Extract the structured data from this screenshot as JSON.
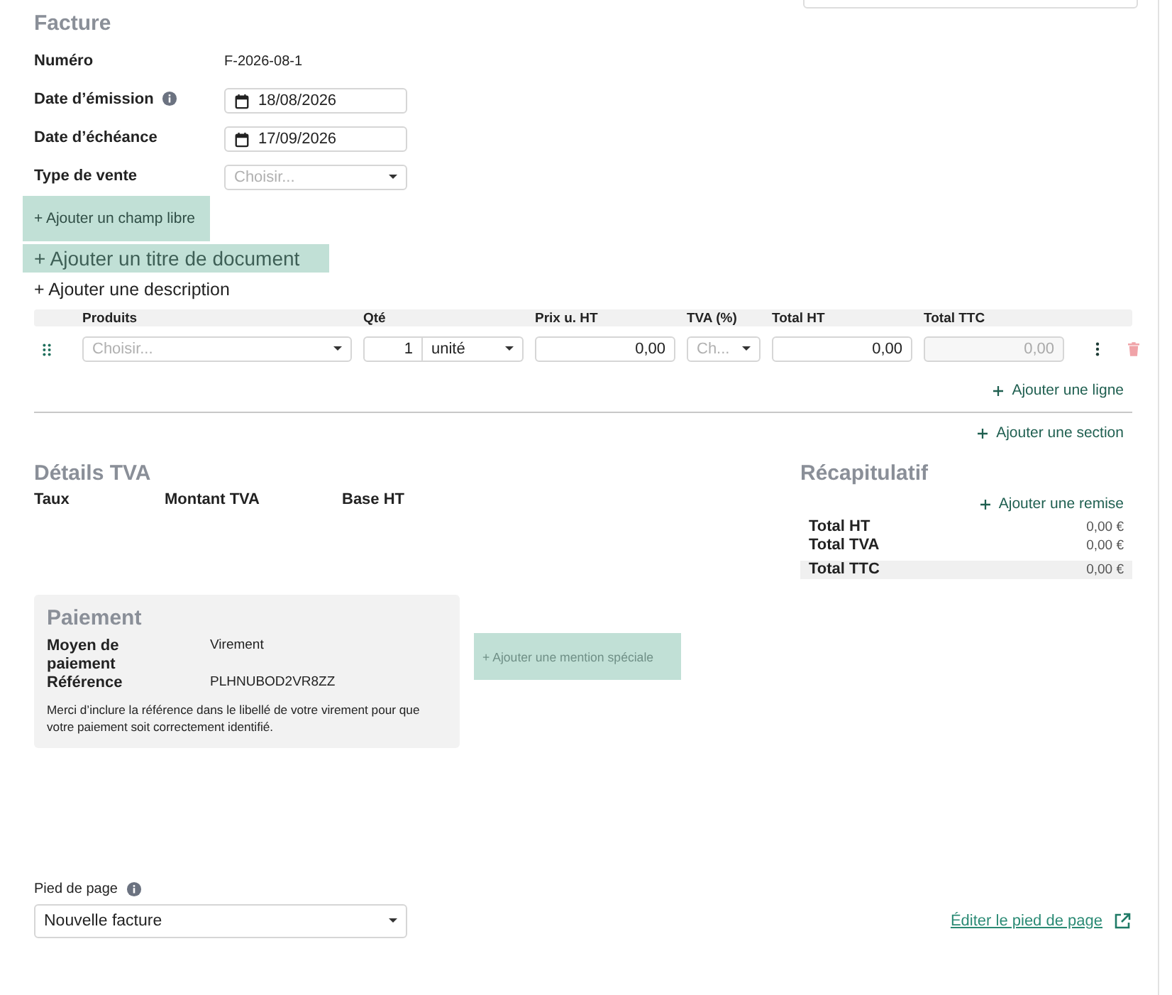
{
  "invoice": {
    "title": "Facture",
    "fields": [
      {
        "label": "Numéro",
        "kind": "text",
        "value": "F-2026-08-1",
        "info": false
      },
      {
        "label": "Date d’émission",
        "kind": "date",
        "value": "18/08/2026",
        "info": true
      },
      {
        "label": "Date d’échéance",
        "kind": "date",
        "value": "17/09/2026",
        "info": false
      },
      {
        "label": "Type de vente",
        "kind": "select",
        "placeholder": "Choisir...",
        "info": false
      }
    ]
  },
  "add_free_field": "+ Ajouter un champ libre",
  "add_title": "+ Ajouter un titre de document",
  "add_description": "+ Ajouter une description",
  "lines": {
    "columns": [
      "Produits",
      "Qté",
      "Prix u. HT",
      "TVA (%)",
      "Total HT",
      "Total TTC"
    ],
    "rows": [
      {
        "product_placeholder": "Choisir...",
        "quantity": "1",
        "unit": "unité",
        "unit_price": "0,00",
        "vat_placeholder": "Ch...",
        "total_ht": "0,00",
        "total_ttc": "0,00"
      }
    ],
    "add_line": "Ajouter une ligne",
    "add_section": "Ajouter une section"
  },
  "vat_details": {
    "title": "Détails TVA",
    "columns": [
      "Taux",
      "Montant TVA",
      "Base HT"
    ]
  },
  "summary": {
    "title": "Récapitulatif",
    "add_discount": "Ajouter une remise",
    "rows": [
      {
        "label": "Total HT",
        "value": "0,00 €",
        "highlighted": false
      },
      {
        "label": "Total TVA",
        "value": "0,00 €",
        "highlighted": false
      },
      {
        "label": "Total TTC",
        "value": "0,00 €",
        "highlighted": true
      }
    ]
  },
  "payment": {
    "title": "Paiement",
    "rows": [
      {
        "label": "Moyen de paiement",
        "value": "Virement"
      },
      {
        "label": "Référence",
        "value": "PLHNUBOD2VR8ZZ"
      }
    ],
    "note": "Merci d’inclure la référence dans le libellé de votre virement pour que votre paiement soit correctement identifié."
  },
  "add_mention": "+ Ajouter une mention spéciale",
  "footer": {
    "label": "Pied de page",
    "info": true,
    "value": "Nouvelle facture",
    "edit_link": "Éditer le pied de page"
  }
}
